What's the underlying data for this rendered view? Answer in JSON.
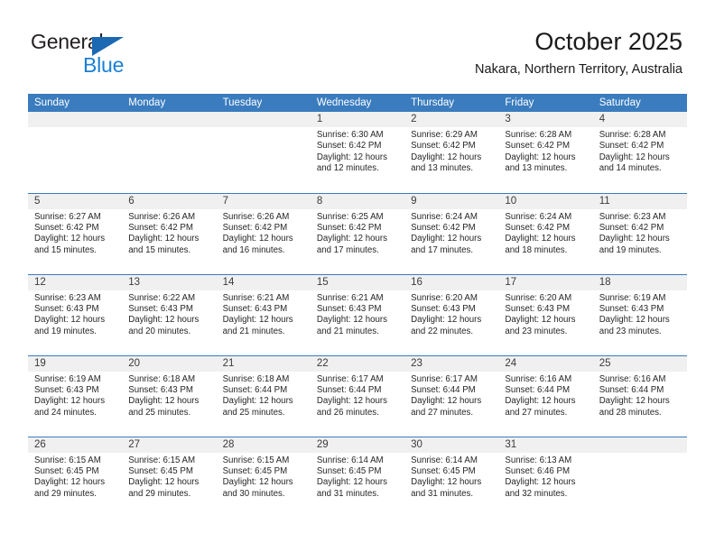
{
  "brand": {
    "name_top": "General",
    "name_bottom": "Blue",
    "triangle_icon": "blue-triangle-logo-mark",
    "color_top": "#231f20",
    "color_bottom": "#1b7fd4",
    "triangle_color": "#1b68b3"
  },
  "header": {
    "title": "October 2025",
    "subtitle": "Nakara, Northern Territory, Australia"
  },
  "theme": {
    "header_bar": "#3a7cbe",
    "daynum_band": "#f0f0f0",
    "row_divider": "#3a7cbe",
    "text": "#262626"
  },
  "weekdays": [
    "Sunday",
    "Monday",
    "Tuesday",
    "Wednesday",
    "Thursday",
    "Friday",
    "Saturday"
  ],
  "weeks": [
    [
      {
        "day": "",
        "empty": true,
        "sunrise": "",
        "sunset": "",
        "daylight_line1": "",
        "daylight_line2": ""
      },
      {
        "day": "",
        "empty": true,
        "sunrise": "",
        "sunset": "",
        "daylight_line1": "",
        "daylight_line2": ""
      },
      {
        "day": "",
        "empty": true,
        "sunrise": "",
        "sunset": "",
        "daylight_line1": "",
        "daylight_line2": ""
      },
      {
        "day": "1",
        "sunrise": "Sunrise: 6:30 AM",
        "sunset": "Sunset: 6:42 PM",
        "daylight_line1": "Daylight: 12 hours",
        "daylight_line2": "and 12 minutes."
      },
      {
        "day": "2",
        "sunrise": "Sunrise: 6:29 AM",
        "sunset": "Sunset: 6:42 PM",
        "daylight_line1": "Daylight: 12 hours",
        "daylight_line2": "and 13 minutes."
      },
      {
        "day": "3",
        "sunrise": "Sunrise: 6:28 AM",
        "sunset": "Sunset: 6:42 PM",
        "daylight_line1": "Daylight: 12 hours",
        "daylight_line2": "and 13 minutes."
      },
      {
        "day": "4",
        "sunrise": "Sunrise: 6:28 AM",
        "sunset": "Sunset: 6:42 PM",
        "daylight_line1": "Daylight: 12 hours",
        "daylight_line2": "and 14 minutes."
      }
    ],
    [
      {
        "day": "5",
        "sunrise": "Sunrise: 6:27 AM",
        "sunset": "Sunset: 6:42 PM",
        "daylight_line1": "Daylight: 12 hours",
        "daylight_line2": "and 15 minutes."
      },
      {
        "day": "6",
        "sunrise": "Sunrise: 6:26 AM",
        "sunset": "Sunset: 6:42 PM",
        "daylight_line1": "Daylight: 12 hours",
        "daylight_line2": "and 15 minutes."
      },
      {
        "day": "7",
        "sunrise": "Sunrise: 6:26 AM",
        "sunset": "Sunset: 6:42 PM",
        "daylight_line1": "Daylight: 12 hours",
        "daylight_line2": "and 16 minutes."
      },
      {
        "day": "8",
        "sunrise": "Sunrise: 6:25 AM",
        "sunset": "Sunset: 6:42 PM",
        "daylight_line1": "Daylight: 12 hours",
        "daylight_line2": "and 17 minutes."
      },
      {
        "day": "9",
        "sunrise": "Sunrise: 6:24 AM",
        "sunset": "Sunset: 6:42 PM",
        "daylight_line1": "Daylight: 12 hours",
        "daylight_line2": "and 17 minutes."
      },
      {
        "day": "10",
        "sunrise": "Sunrise: 6:24 AM",
        "sunset": "Sunset: 6:42 PM",
        "daylight_line1": "Daylight: 12 hours",
        "daylight_line2": "and 18 minutes."
      },
      {
        "day": "11",
        "sunrise": "Sunrise: 6:23 AM",
        "sunset": "Sunset: 6:42 PM",
        "daylight_line1": "Daylight: 12 hours",
        "daylight_line2": "and 19 minutes."
      }
    ],
    [
      {
        "day": "12",
        "sunrise": "Sunrise: 6:23 AM",
        "sunset": "Sunset: 6:43 PM",
        "daylight_line1": "Daylight: 12 hours",
        "daylight_line2": "and 19 minutes."
      },
      {
        "day": "13",
        "sunrise": "Sunrise: 6:22 AM",
        "sunset": "Sunset: 6:43 PM",
        "daylight_line1": "Daylight: 12 hours",
        "daylight_line2": "and 20 minutes."
      },
      {
        "day": "14",
        "sunrise": "Sunrise: 6:21 AM",
        "sunset": "Sunset: 6:43 PM",
        "daylight_line1": "Daylight: 12 hours",
        "daylight_line2": "and 21 minutes."
      },
      {
        "day": "15",
        "sunrise": "Sunrise: 6:21 AM",
        "sunset": "Sunset: 6:43 PM",
        "daylight_line1": "Daylight: 12 hours",
        "daylight_line2": "and 21 minutes."
      },
      {
        "day": "16",
        "sunrise": "Sunrise: 6:20 AM",
        "sunset": "Sunset: 6:43 PM",
        "daylight_line1": "Daylight: 12 hours",
        "daylight_line2": "and 22 minutes."
      },
      {
        "day": "17",
        "sunrise": "Sunrise: 6:20 AM",
        "sunset": "Sunset: 6:43 PM",
        "daylight_line1": "Daylight: 12 hours",
        "daylight_line2": "and 23 minutes."
      },
      {
        "day": "18",
        "sunrise": "Sunrise: 6:19 AM",
        "sunset": "Sunset: 6:43 PM",
        "daylight_line1": "Daylight: 12 hours",
        "daylight_line2": "and 23 minutes."
      }
    ],
    [
      {
        "day": "19",
        "sunrise": "Sunrise: 6:19 AM",
        "sunset": "Sunset: 6:43 PM",
        "daylight_line1": "Daylight: 12 hours",
        "daylight_line2": "and 24 minutes."
      },
      {
        "day": "20",
        "sunrise": "Sunrise: 6:18 AM",
        "sunset": "Sunset: 6:43 PM",
        "daylight_line1": "Daylight: 12 hours",
        "daylight_line2": "and 25 minutes."
      },
      {
        "day": "21",
        "sunrise": "Sunrise: 6:18 AM",
        "sunset": "Sunset: 6:44 PM",
        "daylight_line1": "Daylight: 12 hours",
        "daylight_line2": "and 25 minutes."
      },
      {
        "day": "22",
        "sunrise": "Sunrise: 6:17 AM",
        "sunset": "Sunset: 6:44 PM",
        "daylight_line1": "Daylight: 12 hours",
        "daylight_line2": "and 26 minutes."
      },
      {
        "day": "23",
        "sunrise": "Sunrise: 6:17 AM",
        "sunset": "Sunset: 6:44 PM",
        "daylight_line1": "Daylight: 12 hours",
        "daylight_line2": "and 27 minutes."
      },
      {
        "day": "24",
        "sunrise": "Sunrise: 6:16 AM",
        "sunset": "Sunset: 6:44 PM",
        "daylight_line1": "Daylight: 12 hours",
        "daylight_line2": "and 27 minutes."
      },
      {
        "day": "25",
        "sunrise": "Sunrise: 6:16 AM",
        "sunset": "Sunset: 6:44 PM",
        "daylight_line1": "Daylight: 12 hours",
        "daylight_line2": "and 28 minutes."
      }
    ],
    [
      {
        "day": "26",
        "sunrise": "Sunrise: 6:15 AM",
        "sunset": "Sunset: 6:45 PM",
        "daylight_line1": "Daylight: 12 hours",
        "daylight_line2": "and 29 minutes."
      },
      {
        "day": "27",
        "sunrise": "Sunrise: 6:15 AM",
        "sunset": "Sunset: 6:45 PM",
        "daylight_line1": "Daylight: 12 hours",
        "daylight_line2": "and 29 minutes."
      },
      {
        "day": "28",
        "sunrise": "Sunrise: 6:15 AM",
        "sunset": "Sunset: 6:45 PM",
        "daylight_line1": "Daylight: 12 hours",
        "daylight_line2": "and 30 minutes."
      },
      {
        "day": "29",
        "sunrise": "Sunrise: 6:14 AM",
        "sunset": "Sunset: 6:45 PM",
        "daylight_line1": "Daylight: 12 hours",
        "daylight_line2": "and 31 minutes."
      },
      {
        "day": "30",
        "sunrise": "Sunrise: 6:14 AM",
        "sunset": "Sunset: 6:45 PM",
        "daylight_line1": "Daylight: 12 hours",
        "daylight_line2": "and 31 minutes."
      },
      {
        "day": "31",
        "sunrise": "Sunrise: 6:13 AM",
        "sunset": "Sunset: 6:46 PM",
        "daylight_line1": "Daylight: 12 hours",
        "daylight_line2": "and 32 minutes."
      },
      {
        "day": "",
        "empty": true,
        "sunrise": "",
        "sunset": "",
        "daylight_line1": "",
        "daylight_line2": ""
      }
    ]
  ]
}
